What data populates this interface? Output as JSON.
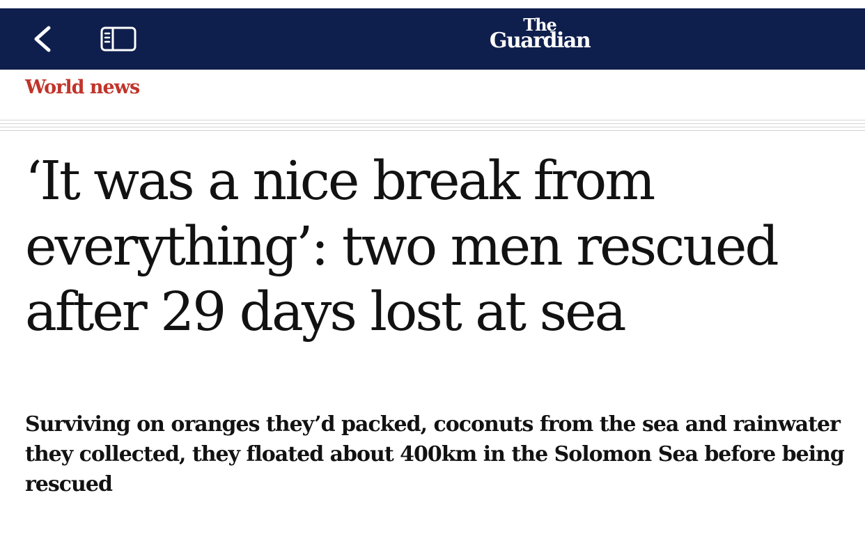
{
  "navbar": {
    "brand_line1": "The",
    "brand_line2": "Guardian",
    "back_icon": "chevron-left-icon",
    "sidebar_icon": "sidebar-panel-icon",
    "background_color": "#0f1f4d"
  },
  "section": {
    "label": "World news",
    "color": "#c0342a"
  },
  "article": {
    "headline": "‘It was a nice break from everything’: two men rescued after 29 days lost at sea",
    "standfirst": "Surviving on oranges they’d packed, coconuts from the sea and rainwater they collected, they floated about 400km in the Solomon Sea before being rescued"
  }
}
